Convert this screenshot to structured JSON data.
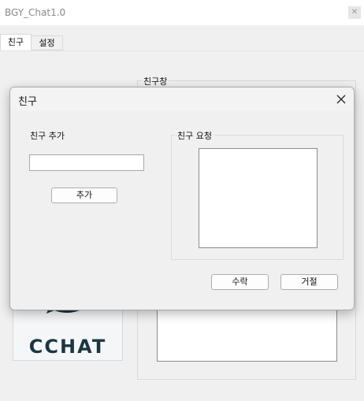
{
  "window": {
    "title": "BGY_Chat1.0",
    "close_glyph": "✕"
  },
  "tabs": [
    {
      "label": "친구"
    },
    {
      "label": "설정"
    }
  ],
  "chatroom": {
    "group_label": "친구창"
  },
  "logo": {
    "text": "CCHAT",
    "colors": {
      "mark": "#1d3540",
      "text": "#1d3540"
    }
  },
  "dialog": {
    "title": "친구",
    "add_label": "친구 추가",
    "input_value": "",
    "add_button": "추가",
    "request_group_label": "친구 요청",
    "accept_button": "수락",
    "reject_button": "거절"
  }
}
